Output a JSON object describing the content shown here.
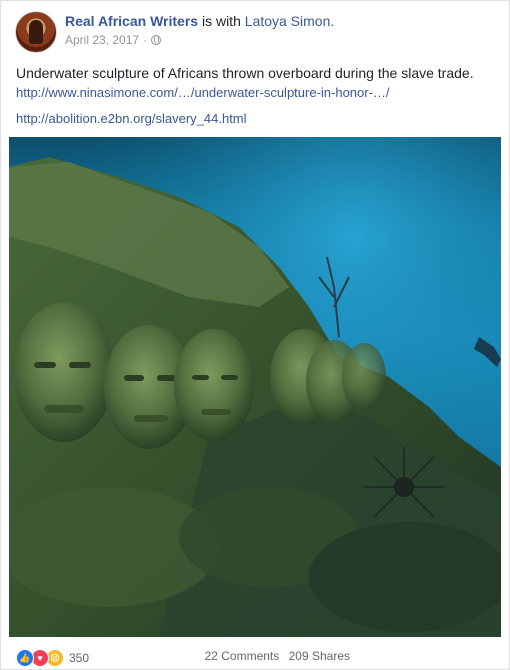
{
  "post": {
    "page_name": "Real African Writers",
    "with_text": "is with",
    "tagged_name": "Latoya Simon.",
    "date": "April 23, 2017",
    "separator": "·",
    "body": "Underwater sculpture of Africans thrown overboard during the slave trade.",
    "links": [
      "http://www.ninasimone.com/…/underwater-sculpture-in-honor-…/",
      "http://abolition.e2bn.org/slavery_44.html"
    ]
  },
  "footer": {
    "reaction_count": "350",
    "comments": "22 Comments",
    "shares": "209 Shares"
  },
  "colors": {
    "link": "#385898",
    "like": "#1877f2",
    "love": "#f33e58",
    "sad": "#f7b928"
  },
  "icons": [
    "globe-icon",
    "like-icon",
    "love-icon",
    "sad-icon"
  ]
}
